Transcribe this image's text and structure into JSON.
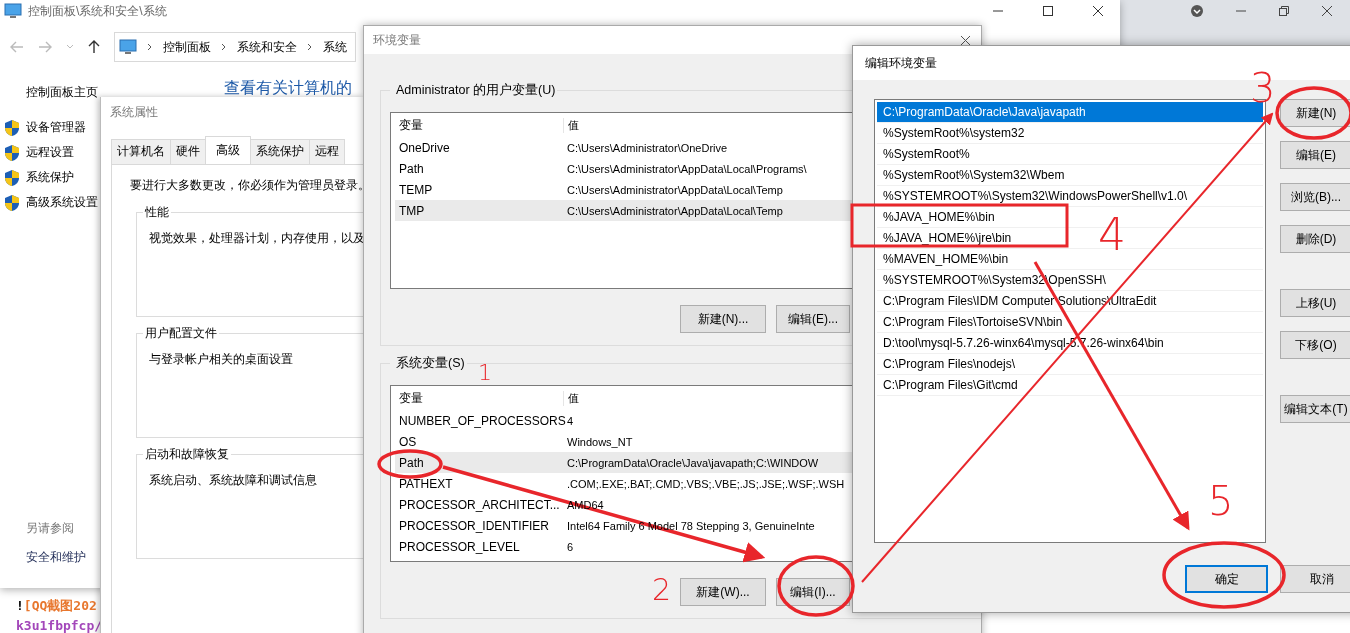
{
  "control_panel": {
    "title": "控制面板\\系统和安全\\系统",
    "breadcrumb": [
      "控制面板",
      "系统和安全",
      "系统"
    ],
    "home_link": "控制面板主页",
    "main_heading": "查看有关计算机的",
    "tasks": [
      "设备管理器",
      "远程设置",
      "系统保护",
      "高级系统设置"
    ],
    "see_also_heading": "另请参阅",
    "see_also_links": [
      "安全和维护"
    ]
  },
  "editor_snippet": [
    [
      {
        "text": "!"
      },
      {
        "text": "[QQ截图202",
        "color": "#e8772e"
      }
    ],
    [
      {
        "text": "k3u1fbpfcp/",
        "color": "#a347ba"
      }
    ]
  ],
  "system_properties": {
    "title": "系统属性",
    "tabs": [
      {
        "label": "计算机名",
        "selected": false
      },
      {
        "label": "硬件",
        "selected": false
      },
      {
        "label": "高级",
        "selected": true
      },
      {
        "label": "系统保护",
        "selected": false
      },
      {
        "label": "远程",
        "selected": false
      }
    ],
    "admin_note": "要进行大多数更改，你必须作为管理员登录。",
    "groups": [
      {
        "title": "性能",
        "description": "视觉效果，处理器计划，内存使用，以及"
      },
      {
        "title": "用户配置文件",
        "description": "与登录帐户相关的桌面设置"
      },
      {
        "title": "启动和故障恢复",
        "description": "系统启动、系统故障和调试信息"
      }
    ]
  },
  "environment_variables": {
    "title": "环境变量",
    "sections": [
      {
        "title": "Administrator 的用户变量(U)",
        "columns": [
          "变量",
          "值"
        ],
        "rows": [
          {
            "name": "OneDrive",
            "value": "C:\\Users\\Administrator\\OneDrive",
            "selected": false
          },
          {
            "name": "Path",
            "value": "C:\\Users\\Administrator\\AppData\\Local\\Programs\\",
            "selected": false
          },
          {
            "name": "TEMP",
            "value": "C:\\Users\\Administrator\\AppData\\Local\\Temp",
            "selected": false
          },
          {
            "name": "TMP",
            "value": "C:\\Users\\Administrator\\AppData\\Local\\Temp",
            "selected": true
          }
        ],
        "buttons": [
          "新建(N)...",
          "编辑(E)..."
        ]
      },
      {
        "title": "系统变量(S)",
        "columns": [
          "变量",
          "值"
        ],
        "rows": [
          {
            "name": "NUMBER_OF_PROCESSORS",
            "value": "4",
            "selected": false
          },
          {
            "name": "OS",
            "value": "Windows_NT",
            "selected": false
          },
          {
            "name": "Path",
            "value": "C:\\ProgramData\\Oracle\\Java\\javapath;C:\\WINDOW",
            "selected": true
          },
          {
            "name": "PATHEXT",
            "value": ".COM;.EXE;.BAT;.CMD;.VBS;.VBE;.JS;.JSE;.WSF;.WSH",
            "selected": false
          },
          {
            "name": "PROCESSOR_ARCHITECT...",
            "value": "AMD64",
            "selected": false
          },
          {
            "name": "PROCESSOR_IDENTIFIER",
            "value": "Intel64 Family 6 Model 78 Stepping 3, GenuineInte",
            "selected": false
          },
          {
            "name": "PROCESSOR_LEVEL",
            "value": "6",
            "selected": false
          }
        ],
        "buttons": [
          "新建(W)...",
          "编辑(I)..."
        ]
      }
    ]
  },
  "edit_variable": {
    "title": "编辑环境变量",
    "entries": [
      {
        "text": "C:\\ProgramData\\Oracle\\Java\\javapath",
        "selected": true
      },
      {
        "text": "%SystemRoot%\\system32",
        "selected": false
      },
      {
        "text": "%SystemRoot%",
        "selected": false
      },
      {
        "text": "%SystemRoot%\\System32\\Wbem",
        "selected": false
      },
      {
        "text": "%SYSTEMROOT%\\System32\\WindowsPowerShell\\v1.0\\",
        "selected": false
      },
      {
        "text": "%JAVA_HOME%\\bin",
        "selected": false
      },
      {
        "text": "%JAVA_HOME%\\jre\\bin",
        "selected": false
      },
      {
        "text": "%MAVEN_HOME%\\bin",
        "selected": false
      },
      {
        "text": "%SYSTEMROOT%\\System32\\OpenSSH\\",
        "selected": false
      },
      {
        "text": "C:\\Program Files\\IDM Computer Solutions\\UltraEdit",
        "selected": false
      },
      {
        "text": "C:\\Program Files\\TortoiseSVN\\bin",
        "selected": false
      },
      {
        "text": "D:\\tool\\mysql-5.7.26-winx64\\mysql-5.7.26-winx64\\bin",
        "selected": false
      },
      {
        "text": "C:\\Program Files\\nodejs\\",
        "selected": false
      },
      {
        "text": "C:\\Program Files\\Git\\cmd",
        "selected": false
      }
    ],
    "side_button_groups": [
      [
        "新建(N)",
        "编辑(E)",
        "浏览(B)...",
        "删除(D)"
      ],
      [
        "上移(U)",
        "下移(O)"
      ],
      [
        "编辑文本(T)"
      ]
    ],
    "footer_buttons": [
      {
        "label": "确定",
        "default": true
      },
      {
        "label": "取消",
        "default": false
      }
    ]
  },
  "annotations": {
    "step_numbers": [
      "1",
      "2",
      "3",
      "4",
      "5"
    ]
  }
}
